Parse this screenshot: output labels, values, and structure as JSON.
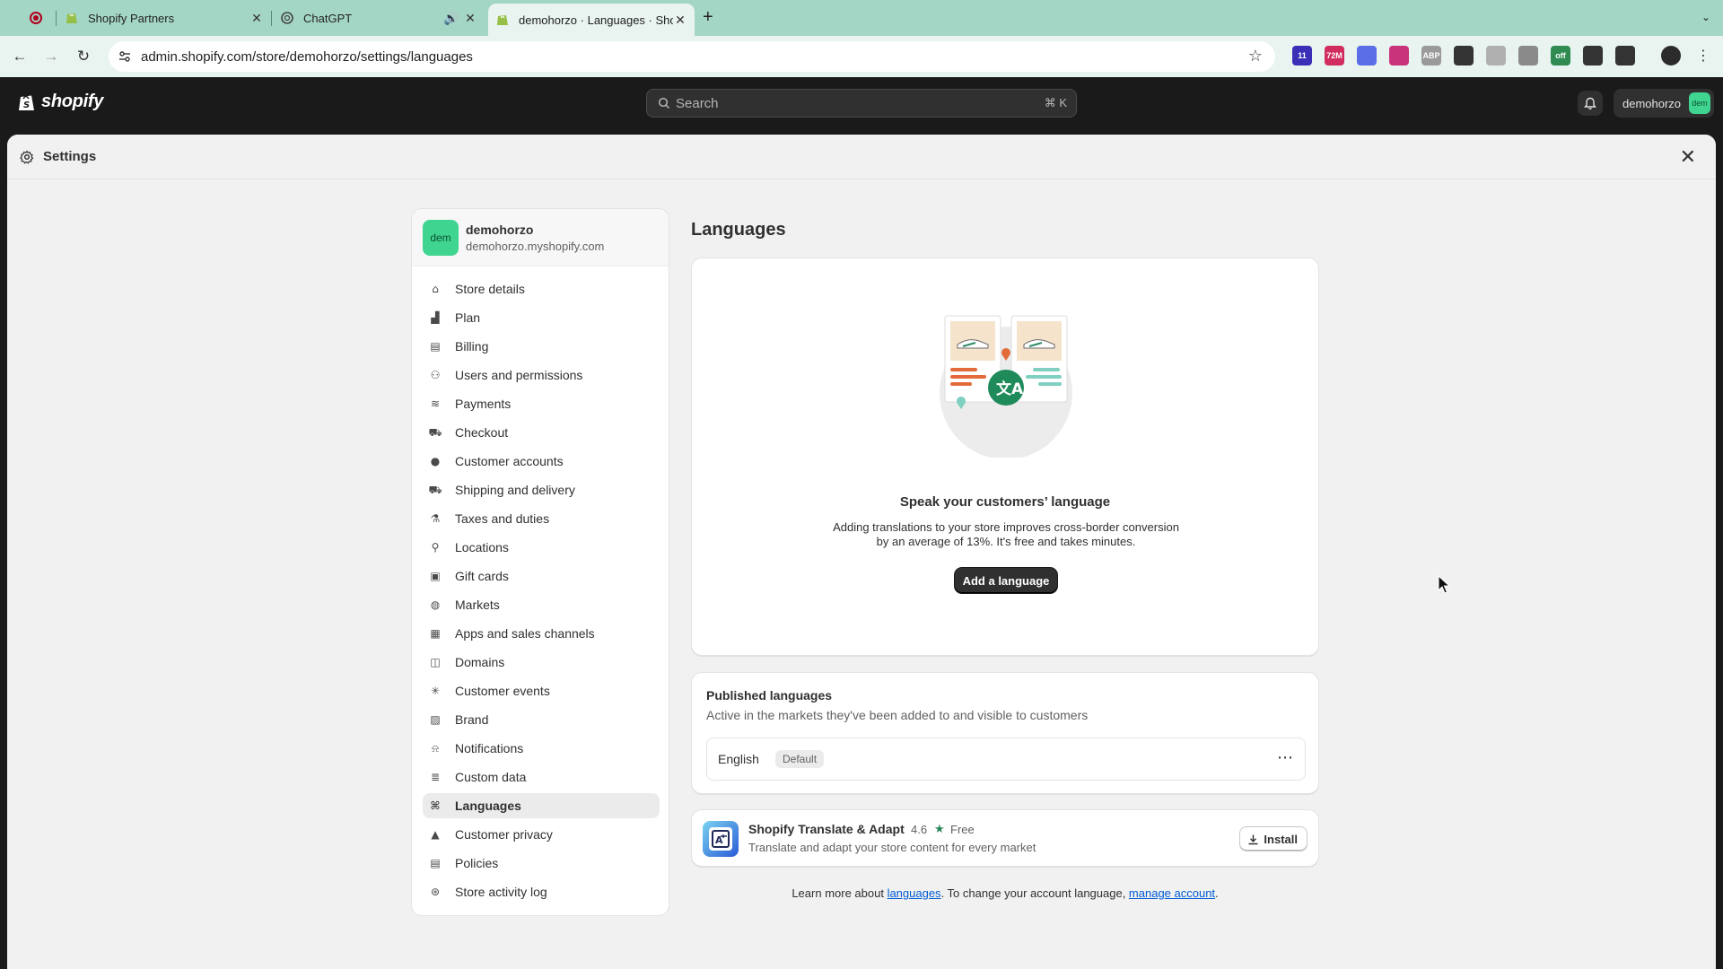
{
  "browser": {
    "tabs": [
      {
        "title": "Shopify Partners"
      },
      {
        "title": "ChatGPT"
      },
      {
        "title": "demohorzo · Languages · Sho"
      }
    ],
    "url": "admin.shopify.com/store/demohorzo/settings/languages",
    "extensions": [
      {
        "name": "ext-badge-icon",
        "text": "11",
        "color": "#3b2fb8"
      },
      {
        "name": "ext-72m-icon",
        "text": "72M",
        "color": "#d12d5f"
      },
      {
        "name": "ext-flower-icon",
        "text": "",
        "color": "#5b6ee8"
      },
      {
        "name": "ext-circle-icon",
        "text": "",
        "color": "#c8337c"
      },
      {
        "name": "ext-abp-icon",
        "text": "ABP",
        "color": "#9a9a9a"
      },
      {
        "name": "ext-pen-icon",
        "text": "",
        "color": "#333333"
      },
      {
        "name": "ext-edit-icon",
        "text": "",
        "color": "#b0b0b0"
      },
      {
        "name": "ext-code-icon",
        "text": "",
        "color": "#8a8a8a"
      },
      {
        "name": "ext-off-icon",
        "text": "off",
        "color": "#2f8b52"
      },
      {
        "name": "ext-robot-icon",
        "text": "",
        "color": "#333333"
      },
      {
        "name": "ext-puzzle-icon",
        "text": "",
        "color": "#333333"
      }
    ]
  },
  "topbar": {
    "logo_text": "shopify",
    "search_placeholder": "Search",
    "search_shortcut": "⌘ K",
    "account_name": "demohorzo",
    "account_avatar": "dem"
  },
  "modal": {
    "title": "Settings"
  },
  "sidebar": {
    "store_avatar": "dem",
    "store_name": "demohorzo",
    "store_domain": "demohorzo.myshopify.com",
    "items": [
      {
        "label": "Store details",
        "icon": "store-icon"
      },
      {
        "label": "Plan",
        "icon": "plan-icon"
      },
      {
        "label": "Billing",
        "icon": "billing-icon"
      },
      {
        "label": "Users and permissions",
        "icon": "users-icon"
      },
      {
        "label": "Payments",
        "icon": "payments-icon"
      },
      {
        "label": "Checkout",
        "icon": "cart-icon"
      },
      {
        "label": "Customer accounts",
        "icon": "person-icon"
      },
      {
        "label": "Shipping and delivery",
        "icon": "truck-icon"
      },
      {
        "label": "Taxes and duties",
        "icon": "tax-icon"
      },
      {
        "label": "Locations",
        "icon": "location-icon"
      },
      {
        "label": "Gift cards",
        "icon": "gift-icon"
      },
      {
        "label": "Markets",
        "icon": "globe-icon"
      },
      {
        "label": "Apps and sales channels",
        "icon": "apps-icon"
      },
      {
        "label": "Domains",
        "icon": "domain-icon"
      },
      {
        "label": "Customer events",
        "icon": "events-icon"
      },
      {
        "label": "Brand",
        "icon": "brand-icon"
      },
      {
        "label": "Notifications",
        "icon": "bell-icon"
      },
      {
        "label": "Custom data",
        "icon": "database-icon"
      },
      {
        "label": "Languages",
        "icon": "language-icon"
      },
      {
        "label": "Customer privacy",
        "icon": "lock-icon"
      },
      {
        "label": "Policies",
        "icon": "policy-icon"
      },
      {
        "label": "Store activity log",
        "icon": "activity-icon"
      }
    ],
    "active_item": "Languages"
  },
  "main": {
    "title": "Languages",
    "empty_state": {
      "heading": "Speak your customers’ language",
      "body": "Adding translations to your store improves cross-border conversion by an average of 13%. It's free and takes minutes.",
      "button": "Add a language"
    },
    "published": {
      "heading": "Published languages",
      "subheading": "Active in the markets they've been added to and visible to customers",
      "languages": [
        {
          "name": "English",
          "badge": "Default"
        }
      ]
    },
    "app": {
      "name": "Shopify Translate & Adapt",
      "rating": "4.6",
      "price": "Free",
      "description": "Translate and adapt your store content for every market",
      "button": "Install"
    },
    "footer": {
      "prefix": "Learn more about ",
      "link1": "languages",
      "middle": ". To change your account language, ",
      "link2": "manage account",
      "suffix": "."
    }
  },
  "colors": {
    "tabstrip": "#a4d6c6",
    "appbar": "#1a1a1a",
    "accent_green": "#3fd591",
    "primary_button": "#303030",
    "link": "#005bd3"
  }
}
